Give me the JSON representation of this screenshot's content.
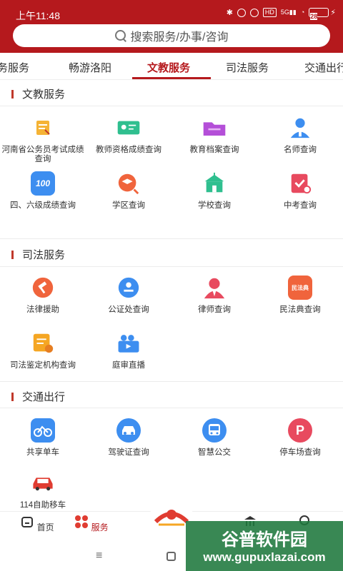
{
  "status": {
    "time": "上午11:48",
    "battery": "28"
  },
  "search": {
    "placeholder": "搜索服务/办事/咨询"
  },
  "tabs": [
    "务服务",
    "畅游洛阳",
    "文教服务",
    "司法服务",
    "交通出行"
  ],
  "sections": [
    {
      "title": "文教服务",
      "items": [
        {
          "label": "河南省公务员考试成绩查询",
          "icon": "exam-score-icon"
        },
        {
          "label": "教师资格成绩查询",
          "icon": "teacher-cert-icon"
        },
        {
          "label": "教育档案查询",
          "icon": "folder-icon"
        },
        {
          "label": "名师查询",
          "icon": "teacher-person-icon"
        },
        {
          "label": "四、六级成绩查询",
          "icon": "cet-100-icon"
        },
        {
          "label": "学区查询",
          "icon": "graduation-search-icon"
        },
        {
          "label": "学校查询",
          "icon": "school-building-icon"
        },
        {
          "label": "中考查询",
          "icon": "exam-check-icon"
        }
      ]
    },
    {
      "title": "司法服务",
      "items": [
        {
          "label": "法律援助",
          "icon": "gavel-icon"
        },
        {
          "label": "公证处查询",
          "icon": "notary-search-icon"
        },
        {
          "label": "律师查询",
          "icon": "lawyer-icon"
        },
        {
          "label": "民法典查询",
          "icon": "civil-code-book-icon"
        },
        {
          "label": "司法鉴定机构查询",
          "icon": "forensic-institution-icon"
        },
        {
          "label": "庭审直播",
          "icon": "live-video-icon"
        }
      ]
    },
    {
      "title": "交通出行",
      "items": [
        {
          "label": "共享单车",
          "icon": "bicycle-icon"
        },
        {
          "label": "驾驶证查询",
          "icon": "car-license-icon"
        },
        {
          "label": "智慧公交",
          "icon": "bus-icon"
        },
        {
          "label": "停车场查询",
          "icon": "parking-icon"
        },
        {
          "label": "114自助移车",
          "icon": "tow-car-icon"
        }
      ]
    }
  ],
  "civil_code_text": "民法典",
  "cet_text": "100",
  "nav": [
    {
      "label": "首页",
      "icon": "home-icon"
    },
    {
      "label": "服务",
      "icon": "services-grid-icon"
    }
  ],
  "watermark": {
    "line1": "谷普软件园",
    "line2": "www.gupuxlazai.com"
  },
  "colors": {
    "primary": "#b5191d",
    "accent_orange": "#f08a24",
    "accent_blue": "#3d8ef0",
    "accent_green": "#2fbf8f"
  }
}
